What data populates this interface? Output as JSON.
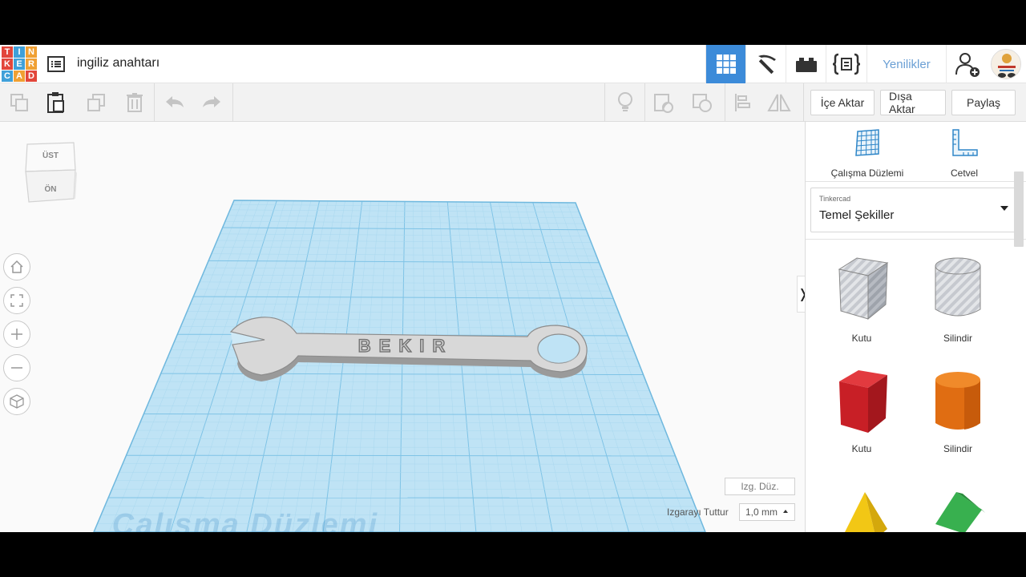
{
  "app": {
    "logo_letters": [
      "T",
      "I",
      "N",
      "K",
      "E",
      "R",
      "C",
      "A",
      "D"
    ],
    "logo_colors": [
      "#e2463b",
      "#3fa0d9",
      "#f0a033",
      "#e2463b",
      "#3fa0d9",
      "#f0a033",
      "#3fa0d9",
      "#f0a033",
      "#e2463b"
    ],
    "document_title": "ingiliz anahtarı"
  },
  "topbar": {
    "buttons": [
      {
        "name": "3d-design-view",
        "icon": "grid-icon",
        "active": true
      },
      {
        "name": "blocks-view",
        "icon": "pickaxe-icon",
        "active": false
      },
      {
        "name": "bricks-view",
        "icon": "brick-icon",
        "active": false
      },
      {
        "name": "codeblocks-view",
        "icon": "code-braces-icon",
        "active": false
      }
    ],
    "news_label": "Yenilikler",
    "accent": "#3c8bd9"
  },
  "toolbar": {
    "import_label": "İçe Aktar",
    "export_label": "Dışa Aktar",
    "share_label": "Paylaş"
  },
  "viewcube": {
    "top_label": "ÜST",
    "front_label": "ÖN"
  },
  "workplane": {
    "watermark": "Çalışma Düzlemi",
    "object_text": "BEKIR",
    "edit_grid_label": "Izg. Düz.",
    "snap_label": "Izgarayı Tuttur",
    "snap_value": "1,0 mm"
  },
  "panel": {
    "workplane_tool": "Çalışma Düzlemi",
    "ruler_tool": "Cetvel",
    "library_owner": "Tinkercad",
    "library_name": "Temel Şekiller",
    "shapes": [
      {
        "label": "Kutu",
        "style": "hole"
      },
      {
        "label": "Silindir",
        "style": "hole"
      },
      {
        "label": "Kutu",
        "color": "#d9222a"
      },
      {
        "label": "Silindir",
        "color": "#e8761a"
      },
      {
        "label": "",
        "color": "#f1c40f"
      },
      {
        "label": "",
        "color": "#2fa84a"
      }
    ]
  }
}
